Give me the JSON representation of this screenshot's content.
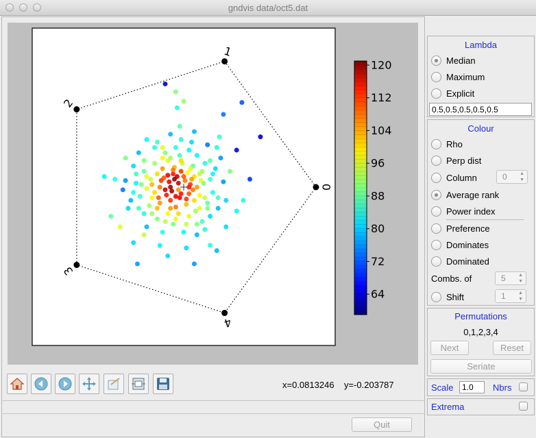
{
  "window": {
    "title": "gndvis data/oct5.dat"
  },
  "plot": {
    "axis_labels": [
      "0",
      "1",
      "2",
      "3",
      "4"
    ],
    "colorbar_ticks": [
      "120",
      "112",
      "104",
      "96",
      "88",
      "80",
      "72",
      "64"
    ]
  },
  "chart_data": {
    "type": "scatter",
    "title": "",
    "xlabel": "",
    "ylabel": "",
    "colorbar": {
      "label": "",
      "min": 59,
      "max": 121,
      "ticks": [
        120,
        112,
        104,
        96,
        88,
        80,
        72,
        64
      ]
    },
    "anchors": [
      {
        "label": "0",
        "x": 1.0,
        "y": 0.0
      },
      {
        "label": "1",
        "x": 0.309,
        "y": 0.951
      },
      {
        "label": "2",
        "x": -0.809,
        "y": 0.588
      },
      {
        "label": "3",
        "x": -0.809,
        "y": -0.588
      },
      {
        "label": "4",
        "x": 0.309,
        "y": -0.951
      }
    ],
    "points": [
      [
        -0.08,
        0.1,
        112
      ],
      [
        -0.11,
        0.04,
        114
      ],
      [
        -0.05,
        0.08,
        116
      ],
      [
        -0.15,
        0.07,
        108
      ],
      [
        -0.02,
        0.12,
        110
      ],
      [
        -0.18,
        0.0,
        106
      ],
      [
        -0.09,
        -0.03,
        118
      ],
      [
        -0.13,
        -0.06,
        112
      ],
      [
        -0.04,
        -0.02,
        104
      ],
      [
        0.01,
        0.05,
        106
      ],
      [
        -0.2,
        0.1,
        100
      ],
      [
        -0.07,
        0.15,
        102
      ],
      [
        0.03,
        0.11,
        98
      ],
      [
        -0.16,
        0.14,
        104
      ],
      [
        -0.12,
        0.2,
        96
      ],
      [
        -0.01,
        0.18,
        94
      ],
      [
        0.05,
        0.02,
        110
      ],
      [
        -0.22,
        -0.04,
        100
      ],
      [
        -0.1,
        -0.1,
        110
      ],
      [
        -0.03,
        -0.08,
        114
      ],
      [
        0.04,
        -0.05,
        108
      ],
      [
        0.08,
        0.08,
        100
      ],
      [
        -0.25,
        0.06,
        94
      ],
      [
        -0.18,
        -0.12,
        104
      ],
      [
        -0.06,
        -0.15,
        106
      ],
      [
        0.02,
        -0.13,
        102
      ],
      [
        0.1,
        0.0,
        104
      ],
      [
        -0.28,
        -0.01,
        96
      ],
      [
        -0.22,
        0.18,
        92
      ],
      [
        0.07,
        0.16,
        88
      ],
      [
        -0.14,
        0.26,
        90
      ],
      [
        -0.03,
        0.24,
        86
      ],
      [
        0.12,
        -0.06,
        98
      ],
      [
        0.12,
        0.1,
        94
      ],
      [
        -0.3,
        0.12,
        88
      ],
      [
        -0.26,
        -0.14,
        92
      ],
      [
        -0.12,
        -0.2,
        98
      ],
      [
        0.04,
        -0.22,
        96
      ],
      [
        0.15,
        0.03,
        90
      ],
      [
        -0.33,
        -0.07,
        86
      ],
      [
        -0.2,
        -0.24,
        90
      ],
      [
        0.09,
        -0.18,
        92
      ],
      [
        -0.06,
        0.3,
        84
      ],
      [
        0.1,
        0.24,
        82
      ],
      [
        0.18,
        -0.12,
        88
      ],
      [
        -0.36,
        0.03,
        82
      ],
      [
        -0.08,
        -0.28,
        90
      ],
      [
        0.16,
        0.18,
        84
      ],
      [
        0.2,
        0.06,
        86
      ],
      [
        -0.3,
        -0.2,
        84
      ],
      [
        0.14,
        -0.26,
        86
      ],
      [
        -0.38,
        0.16,
        80
      ],
      [
        0.0,
        -0.34,
        82
      ],
      [
        -0.22,
        0.3,
        84
      ],
      [
        0.22,
        -0.04,
        84
      ],
      [
        -0.4,
        -0.1,
        78
      ],
      [
        0.24,
        0.14,
        80
      ],
      [
        -0.16,
        -0.34,
        84
      ],
      [
        0.2,
        -0.22,
        80
      ],
      [
        -0.44,
        0.05,
        76
      ],
      [
        0.06,
        0.34,
        80
      ],
      [
        0.26,
        -0.16,
        78
      ],
      [
        -0.34,
        0.26,
        78
      ],
      [
        -0.28,
        -0.3,
        78
      ],
      [
        0.1,
        -0.36,
        78
      ],
      [
        0.3,
        0.04,
        76
      ],
      [
        -0.46,
        -0.02,
        74
      ],
      [
        0.28,
        0.22,
        76
      ],
      [
        -0.1,
        0.4,
        78
      ],
      [
        0.18,
        0.32,
        74
      ],
      [
        -0.07,
        0.06,
        120
      ],
      [
        -0.1,
        0.0,
        118
      ],
      [
        -0.04,
        0.03,
        116
      ],
      [
        -0.12,
        0.09,
        114
      ],
      [
        -0.02,
        -0.05,
        112
      ],
      [
        -0.14,
        -0.02,
        116
      ],
      [
        -0.06,
        -0.07,
        114
      ],
      [
        0.0,
        0.08,
        108
      ],
      [
        -0.17,
        0.05,
        110
      ],
      [
        -0.08,
        0.13,
        106
      ],
      [
        0.02,
        -0.09,
        110
      ],
      [
        -0.19,
        -0.08,
        108
      ],
      [
        0.06,
        0.06,
        104
      ],
      [
        -0.1,
        -0.16,
        104
      ],
      [
        0.07,
        -0.02,
        106
      ],
      [
        -0.24,
        0.02,
        102
      ],
      [
        -0.02,
        0.2,
        100
      ],
      [
        -0.16,
        0.22,
        98
      ],
      [
        0.05,
        0.14,
        96
      ],
      [
        -0.28,
        0.08,
        96
      ],
      [
        0.08,
        -0.1,
        100
      ],
      [
        -0.04,
        -0.2,
        100
      ],
      [
        0.13,
        0.05,
        96
      ],
      [
        -0.24,
        -0.08,
        98
      ],
      [
        0.1,
        -0.28,
        90
      ],
      [
        -0.14,
        -0.26,
        94
      ],
      [
        0.16,
        -0.08,
        94
      ],
      [
        -0.32,
        0.02,
        90
      ],
      [
        -0.2,
        0.34,
        86
      ],
      [
        0.2,
        0.2,
        88
      ],
      [
        -0.02,
        0.36,
        84
      ],
      [
        0.26,
        -0.08,
        86
      ],
      [
        -0.34,
        -0.16,
        86
      ],
      [
        -0.1,
        0.22,
        92
      ],
      [
        0.02,
        -0.28,
        94
      ],
      [
        0.14,
        0.12,
        92
      ],
      [
        -0.3,
        0.2,
        90
      ],
      [
        -0.24,
        -0.2,
        92
      ],
      [
        0.18,
        -0.16,
        90
      ],
      [
        -0.38,
        -0.04,
        84
      ],
      [
        0.04,
        0.0,
        112
      ],
      [
        -0.2,
        -0.16,
        102
      ],
      [
        -0.06,
        -0.24,
        96
      ],
      [
        0.12,
        -0.16,
        96
      ],
      [
        -0.36,
        0.1,
        86
      ],
      [
        0.22,
        0.1,
        82
      ],
      [
        0.16,
        -0.32,
        84
      ],
      [
        -0.42,
        -0.16,
        80
      ],
      [
        0.32,
        -0.1,
        80
      ],
      [
        -0.28,
        0.36,
        82
      ],
      [
        -0.05,
        0.6,
        84
      ],
      [
        0.0,
        0.65,
        92
      ],
      [
        0.3,
        0.55,
        74
      ],
      [
        0.27,
        0.38,
        86
      ],
      [
        -0.03,
        0.46,
        88
      ],
      [
        0.25,
        0.3,
        84
      ],
      [
        0.4,
        0.28,
        66
      ],
      [
        0.08,
        0.42,
        78
      ],
      [
        0.2,
        -0.44,
        84
      ],
      [
        0.02,
        -0.46,
        80
      ],
      [
        -0.18,
        -0.44,
        82
      ],
      [
        -0.38,
        -0.42,
        80
      ],
      [
        -0.55,
        -0.22,
        88
      ],
      [
        -0.52,
        0.06,
        84
      ],
      [
        -0.44,
        0.22,
        90
      ],
      [
        0.45,
        -0.1,
        84
      ],
      [
        0.32,
        -0.3,
        80
      ],
      [
        0.4,
        -0.18,
        82
      ],
      [
        -0.35,
        -0.58,
        76
      ],
      [
        -0.12,
        -0.52,
        80
      ],
      [
        0.08,
        -0.58,
        76
      ],
      [
        0.25,
        -0.48,
        78
      ],
      [
        0.04,
        0.28,
        82
      ],
      [
        -0.16,
        0.3,
        96
      ],
      [
        -0.3,
        -0.36,
        94
      ],
      [
        0.35,
        0.12,
        90
      ],
      [
        -0.14,
        0.78,
        63
      ],
      [
        0.44,
        0.64,
        72
      ],
      [
        0.58,
        0.38,
        64
      ],
      [
        -0.06,
        0.72,
        90
      ],
      [
        -0.6,
        0.08,
        82
      ],
      [
        -0.48,
        -0.3,
        96
      ],
      [
        0.5,
        0.06,
        70
      ]
    ]
  },
  "toolbar": {
    "coords": "x=0.0813246    y=-0.203787",
    "quit": "Quit"
  },
  "panel": {
    "lambda": {
      "title": "Lambda",
      "median": "Median",
      "maximum": "Maximum",
      "explicit": "Explicit",
      "value": "0.5,0.5,0.5,0.5,0.5"
    },
    "colour": {
      "title": "Colour",
      "rho": "Rho",
      "perp": "Perp dist",
      "column": "Column",
      "column_value": "0",
      "avg_rank": "Average rank",
      "power": "Power index",
      "preference": "Preference",
      "dominates": "Dominates",
      "dominated": "Dominated",
      "combs": "Combs. of",
      "combs_value": "5",
      "shift": "Shift",
      "shift_value": "1"
    },
    "permutations": {
      "title": "Permutations",
      "value": "0,1,2,3,4",
      "next": "Next",
      "reset": "Reset",
      "seriate": "Seriate"
    },
    "scale": {
      "label": "Scale",
      "value": "1.0",
      "nbrs": "Nbrs"
    },
    "extrema": {
      "label": "Extrema"
    }
  }
}
